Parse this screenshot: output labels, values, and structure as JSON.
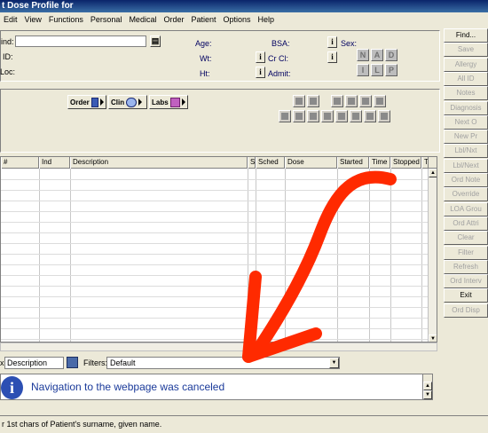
{
  "window": {
    "title": "t Dose Profile for"
  },
  "menu": [
    "Edit",
    "View",
    "Functions",
    "Personal",
    "Medical",
    "Order",
    "Patient",
    "Options",
    "Help"
  ],
  "patient": {
    "find_label": "ind:",
    "id_label": "ID:",
    "loc_label": "Loc:",
    "age_label": "Age:",
    "wt_label": "Wt:",
    "ht_label": "Ht:",
    "bsa_label": "BSA:",
    "crcl_label": "Cr Cl:",
    "admit_label": "Admit:",
    "sex_label": "Sex:",
    "info_glyph": "i",
    "sex_buttons": [
      "N",
      "A",
      "D",
      "I",
      "L",
      "P"
    ]
  },
  "toolbar": {
    "order": "Order",
    "clin": "Clin",
    "labs": "Labs"
  },
  "side_buttons": [
    "Find...",
    "Save",
    "Allergy",
    "All ID",
    "Notes",
    "Diagnosis",
    "Next O",
    "New Pr",
    "Lbl/Nxt",
    "Lbl/Next",
    "Ord Note",
    "Override",
    "LOA Grou",
    "Ord Attri",
    "Clear",
    "Filter",
    "Refresh",
    "Ord Interv",
    "Exit",
    "Ord Disp"
  ],
  "side_enabled": [
    true,
    false,
    false,
    false,
    false,
    false,
    false,
    false,
    false,
    false,
    false,
    false,
    false,
    false,
    false,
    false,
    false,
    false,
    true,
    false
  ],
  "grid": {
    "columns": [
      "#",
      "Ind",
      "Description",
      "S",
      "Sched",
      "Dose",
      "Started",
      "Time",
      "Stopped",
      "T"
    ]
  },
  "filter": {
    "sort_label": "Description",
    "filters_label": "Filters:",
    "filters_value": "Default"
  },
  "message": {
    "text": "Navigation to the webpage was canceled",
    "icon": "info-icon",
    "color": "#1a3a9a"
  },
  "status": {
    "text": "r 1st chars of Patient's surname, given name."
  },
  "annotation": {
    "color": "#ff2a00"
  }
}
